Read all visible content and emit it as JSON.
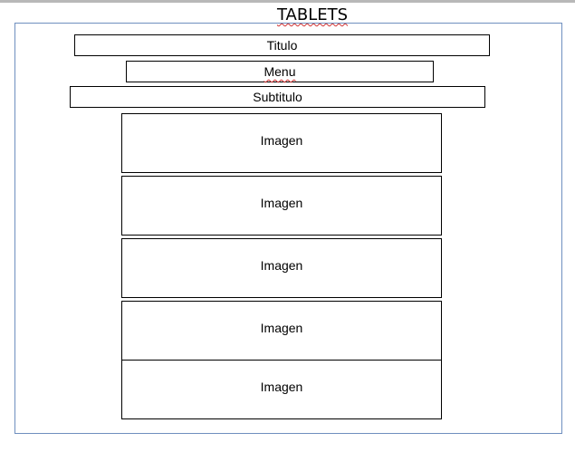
{
  "page": {
    "title": "TABLETS"
  },
  "layout": {
    "titulo": "Titulo",
    "menu": "Menu",
    "subtitulo": "Subtitulo",
    "images": [
      "Imagen",
      "Imagen",
      "Imagen",
      "Imagen",
      "Imagen"
    ]
  },
  "colors": {
    "frame_border": "#6f8fbf",
    "box_border": "#000000",
    "spellcheck_underline": "#d03030"
  }
}
